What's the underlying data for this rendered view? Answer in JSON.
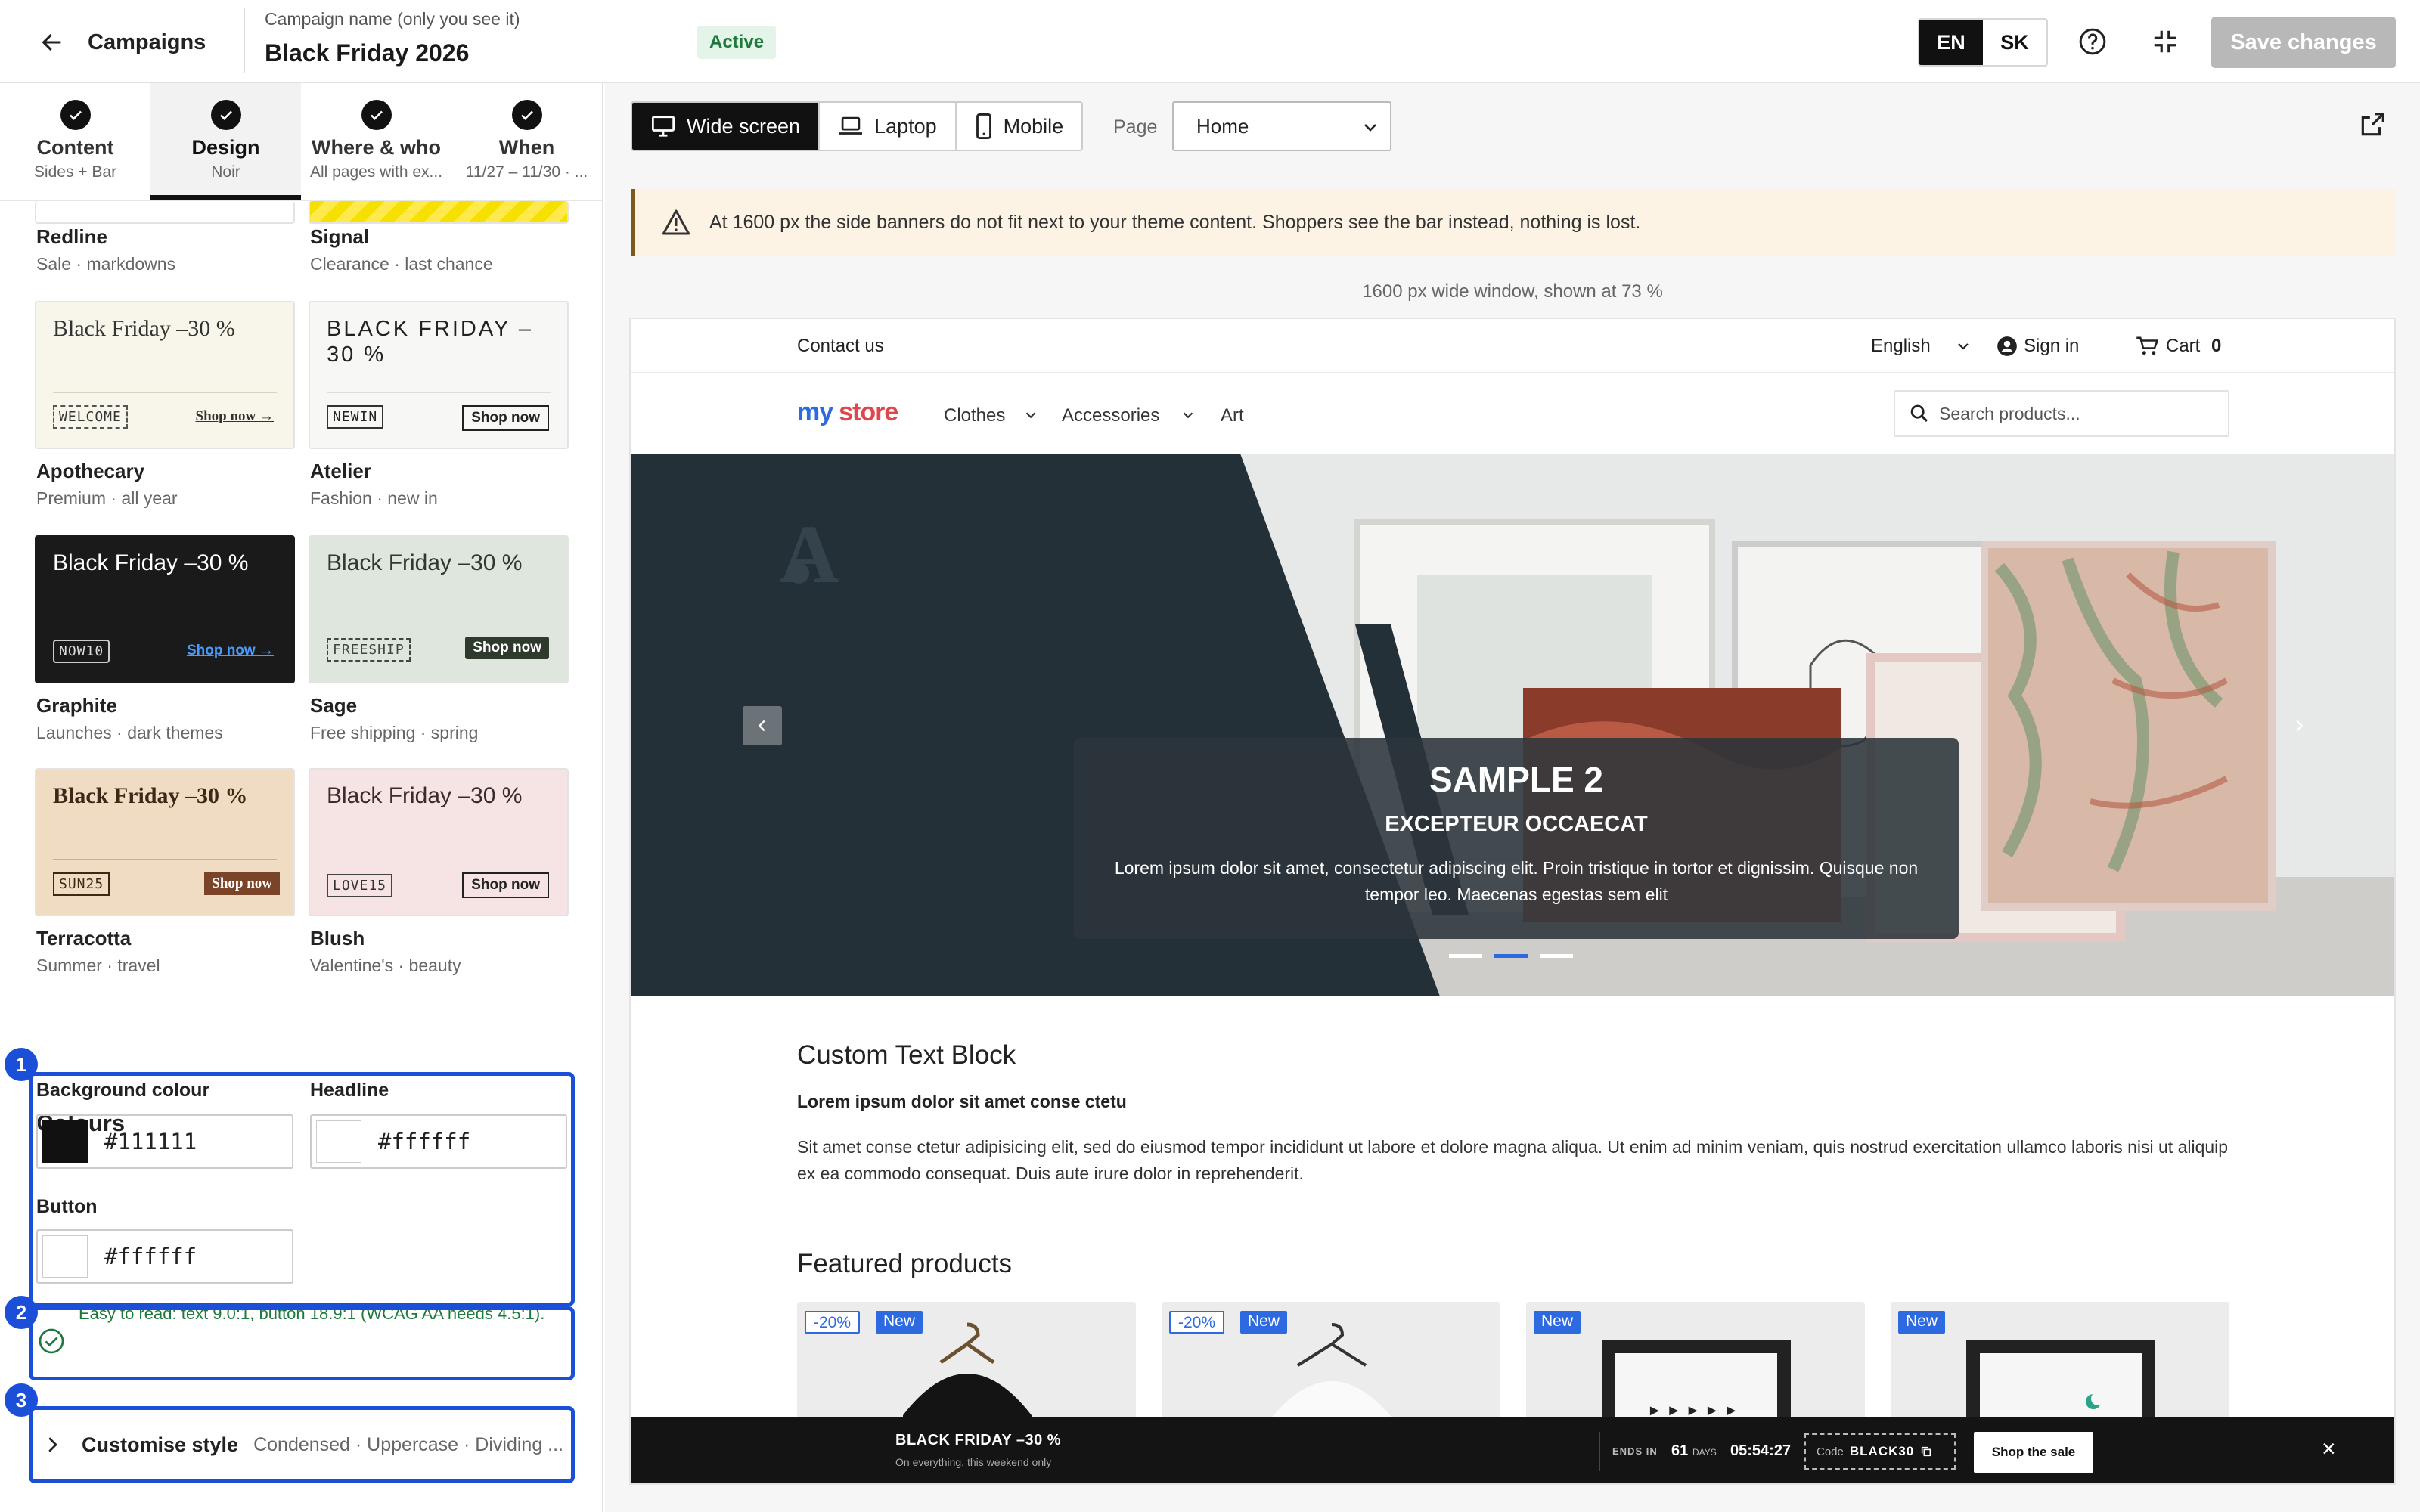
{
  "header": {
    "back_label": "Campaigns",
    "campaign_name_label": "Campaign name (only you see it)",
    "campaign_name": "Black Friday 2026",
    "status": "Active",
    "languages": [
      "EN",
      "SK"
    ],
    "active_language": "EN",
    "save_label": "Save changes"
  },
  "tabs": [
    {
      "label": "Content",
      "sub": "Sides + Bar"
    },
    {
      "label": "Design",
      "sub": "Noir"
    },
    {
      "label": "Where & who",
      "sub": "All pages with ex..."
    },
    {
      "label": "When",
      "sub": "11/27 – 11/30 · ..."
    }
  ],
  "themes": {
    "redline": {
      "name": "Redline",
      "desc": "Sale · markdowns"
    },
    "signal": {
      "name": "Signal",
      "desc": "Clearance · last chance"
    },
    "apothecary": {
      "name": "Apothecary",
      "desc": "Premium · all year",
      "title": "Black Friday –30 %",
      "code": "WELCOME",
      "shop": "Shop now →"
    },
    "atelier": {
      "name": "Atelier",
      "desc": "Fashion · new in",
      "title": "BLACK FRIDAY –30 %",
      "code": "NEWIN",
      "shop": "Shop now"
    },
    "graphite": {
      "name": "Graphite",
      "desc": "Launches · dark themes",
      "title": "Black Friday –30 %",
      "code": "NOW10",
      "shop": "Shop now →"
    },
    "sage": {
      "name": "Sage",
      "desc": "Free shipping · spring",
      "title": "Black Friday –30 %",
      "code": "FREESHIP",
      "shop": "Shop now"
    },
    "terracotta": {
      "name": "Terracotta",
      "desc": "Summer · travel",
      "title": "Black Friday –30 %",
      "code": "SUN25",
      "shop": "Shop now"
    },
    "blush": {
      "name": "Blush",
      "desc": "Valentine's · beauty",
      "title": "Black Friday –30 %",
      "code": "LOVE15",
      "shop": "Shop now"
    }
  },
  "colours": {
    "section_title": "Colours",
    "background_label": "Background colour",
    "background_value": "#111111",
    "headline_label": "Headline",
    "headline_value": "#ffffff",
    "button_label": "Button",
    "button_value": "#ffffff",
    "contrast_note": "Easy to read: text 9.0:1, button 18.9:1 (WCAG AA needs 4.5:1).",
    "swatch_colors": {
      "background": "#111111",
      "headline": "#ffffff",
      "button": "#ffffff"
    }
  },
  "customise": {
    "label": "Customise style",
    "summary": "Condensed · Uppercase · Dividing ..."
  },
  "markers": [
    "1",
    "2",
    "3"
  ],
  "preview": {
    "devices": [
      "Wide screen",
      "Laptop",
      "Mobile"
    ],
    "active_device": "Wide screen",
    "page_label": "Page",
    "page_value": "Home",
    "warning": "At 1600 px the side banners do not fit next to your theme content. Shoppers see the bar instead, nothing is lost.",
    "window_info": "1600 px wide window, shown at 73 %"
  },
  "store": {
    "contact": "Contact us",
    "language": "English",
    "sign_in": "Sign in",
    "cart": "Cart",
    "cart_count": "0",
    "logo_a": "my",
    "logo_b": "store",
    "nav": [
      "Clothes",
      "Accessories",
      "Art"
    ],
    "search_placeholder": "Search products...",
    "hero_title": "SAMPLE 2",
    "hero_subtitle": "EXCEPTEUR OCCAECAT",
    "hero_text": "Lorem ipsum dolor sit amet, consectetur adipiscing elit. Proin tristique in tortor et dignissim. Quisque non tempor leo. Maecenas egestas sem elit",
    "block_title": "Custom Text Block",
    "block_bold": "Lorem ipsum dolor sit amet conse ctetu",
    "block_text": "Sit amet conse ctetur adipisicing elit, sed do eiusmod tempor incididunt ut labore et dolore magna aliqua. Ut enim ad minim veniam, quis nostrud exercitation ullamco laboris nisi ut aliquip ex ea commodo consequat. Duis aute irure dolor in reprehenderit.",
    "featured_title": "Featured products",
    "products": [
      {
        "discount": "-20%",
        "badge": "New"
      },
      {
        "discount": "-20%",
        "badge": "New"
      },
      {
        "badge": "New"
      },
      {
        "badge": "New"
      }
    ]
  },
  "bar": {
    "title": "BLACK FRIDAY –30 %",
    "subtitle": "On everything, this weekend only",
    "ends_in": "ENDS IN",
    "days_num": "61",
    "days_label": "DAYS",
    "time": "05:54:27",
    "code_label": "Code",
    "code": "BLACK30",
    "shop": "Shop the sale",
    "close": "×"
  }
}
